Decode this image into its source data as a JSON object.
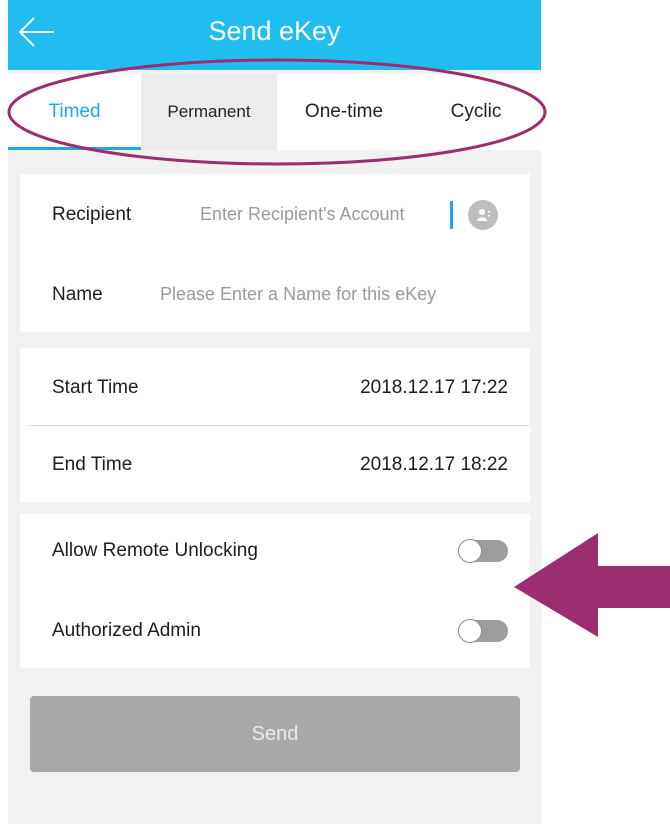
{
  "header": {
    "title": "Send eKey",
    "back_icon": "arrow-left-icon"
  },
  "tabs": [
    {
      "label": "Timed",
      "active": true
    },
    {
      "label": "Permanent",
      "active": false
    },
    {
      "label": "One-time",
      "active": false
    },
    {
      "label": "Cyclic",
      "active": false
    }
  ],
  "recipient": {
    "label": "Recipient",
    "placeholder": "Enter Recipient's Account",
    "contact_icon": "contact-book-icon"
  },
  "name": {
    "label": "Name",
    "placeholder": "Please Enter a Name for this eKey"
  },
  "time": {
    "start_label": "Start Time",
    "start_value": "2018.12.17 17:22",
    "end_label": "End Time",
    "end_value": "2018.12.17 18:22"
  },
  "options": {
    "remote_unlock_label": "Allow Remote Unlocking",
    "remote_unlock_on": false,
    "admin_label": "Authorized Admin",
    "admin_on": false
  },
  "send_label": "Send",
  "colors": {
    "primary": "#1fbdf0",
    "tab_active": "#1fa8e8",
    "annotation": "#9c2d6f",
    "button_disabled": "#a9a9a9"
  }
}
